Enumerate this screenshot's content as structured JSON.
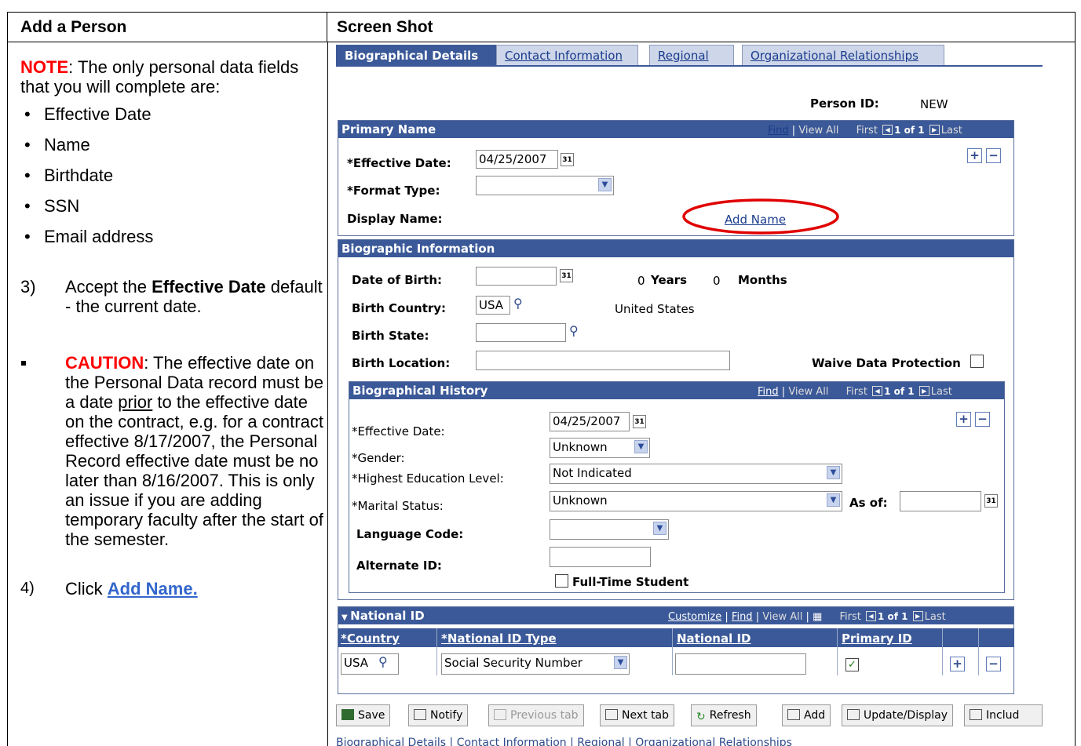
{
  "header": {
    "left": "Add a Person",
    "right": "Screen Shot"
  },
  "instructions": {
    "note_label": "NOTE",
    "note_text": ": The only personal data fields that you will complete are:",
    "fields": [
      "Effective Date",
      "Name",
      "Birthdate",
      "SSN",
      "Email address"
    ],
    "step3_num": "3)",
    "step3_pre": "Accept the ",
    "step3_bold": "Effective Date",
    "step3_post": " default - the current date.",
    "caution_label": "CAUTION",
    "caution_pre": ": The effective date on the Personal Data record must be a date ",
    "caution_underlined": "prior",
    "caution_post": " to the effective date on the contract, e.g. for a contract effective 8/17/2007, the Personal Record effective date must be no later than 8/16/2007. This is only an issue if you are adding temporary faculty after the start of the semester.",
    "step4_num": "4)",
    "step4_pre": "Click ",
    "step4_link": "Add Name."
  },
  "tabs": [
    "Biographical Details",
    "Contact Information",
    "Regional",
    "Organizational Relationships"
  ],
  "person_id": {
    "label": "Person ID:",
    "value": "NEW"
  },
  "primary_name": {
    "title": "Primary Name",
    "nav": {
      "find": "Find",
      "view_all": "View All",
      "first": "First",
      "count": "1 of 1",
      "last": "Last"
    },
    "effective_date_label": "*Effective Date:",
    "effective_date_value": "04/25/2007",
    "format_type_label": "*Format Type:",
    "format_type_value": "",
    "display_name_label": "Display Name:",
    "add_name_link": "Add Name"
  },
  "bio_info": {
    "title": "Biographic Information",
    "dob_label": "Date of Birth:",
    "dob_value": "",
    "years_value": "0",
    "years_label": "Years",
    "months_value": "0",
    "months_label": "Months",
    "birth_country_label": "Birth Country:",
    "birth_country_value": "USA",
    "birth_country_desc": "United States",
    "birth_state_label": "Birth State:",
    "birth_state_value": "",
    "birth_location_label": "Birth Location:",
    "birth_location_value": "",
    "waive_label": "Waive Data Protection"
  },
  "bio_history": {
    "title": "Biographical History",
    "nav": {
      "find": "Find",
      "view_all": "View All",
      "first": "First",
      "count": "1 of 1",
      "last": "Last"
    },
    "effective_date_label": "*Effective Date:",
    "effective_date_value": "04/25/2007",
    "gender_label": "*Gender:",
    "gender_value": "Unknown",
    "education_label": "*Highest Education Level:",
    "education_value": "Not Indicated",
    "marital_label": "*Marital Status:",
    "marital_value": "Unknown",
    "as_of_label": "As of:",
    "as_of_value": "",
    "language_label": "Language Code:",
    "language_value": "",
    "alternate_label": "Alternate ID:",
    "alternate_value": "",
    "fulltime_label": "Full-Time Student"
  },
  "national_id": {
    "title": "National ID",
    "nav": {
      "customize": "Customize",
      "find": "Find",
      "view_all": "View All",
      "first": "First",
      "count": "1 of 1",
      "last": "Last"
    },
    "columns": [
      "*Country",
      "*National ID Type",
      "National ID",
      "Primary ID"
    ],
    "row": {
      "country": "USA",
      "type": "Social Security Number",
      "national_id": "",
      "primary": true
    }
  },
  "toolbar": {
    "save": "Save",
    "notify": "Notify",
    "previous_tab": "Previous tab",
    "next_tab": "Next tab",
    "refresh": "Refresh",
    "add": "Add",
    "update_display": "Update/Display",
    "include": "Includ"
  },
  "footer_links": "Biographical Details | Contact Information | Regional | Organizational Relationships",
  "colors": {
    "accent": "#3b5998",
    "highlight_oval": "#e00000",
    "note_red": "#ff0000",
    "link_blue": "#3366cc"
  }
}
